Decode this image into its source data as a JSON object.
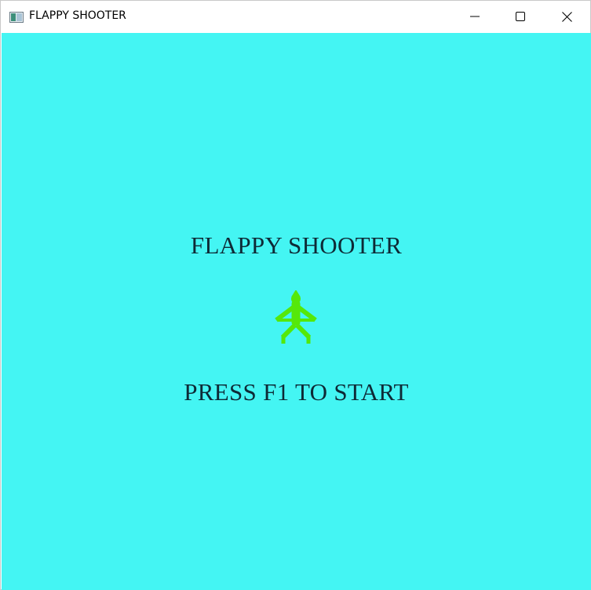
{
  "window": {
    "title": "FLAPPY SHOOTER",
    "app_icon": "app-window-icon",
    "controls": {
      "minimize_icon": "minimize-icon",
      "maximize_icon": "maximize-icon",
      "close_icon": "close-icon"
    }
  },
  "game": {
    "background_color": "#44f5f3",
    "title": "FLAPPY SHOOTER",
    "player_icon": "stick-figure-player-icon",
    "player_color": "#55e80a",
    "prompt": "PRESS F1 TO START"
  }
}
